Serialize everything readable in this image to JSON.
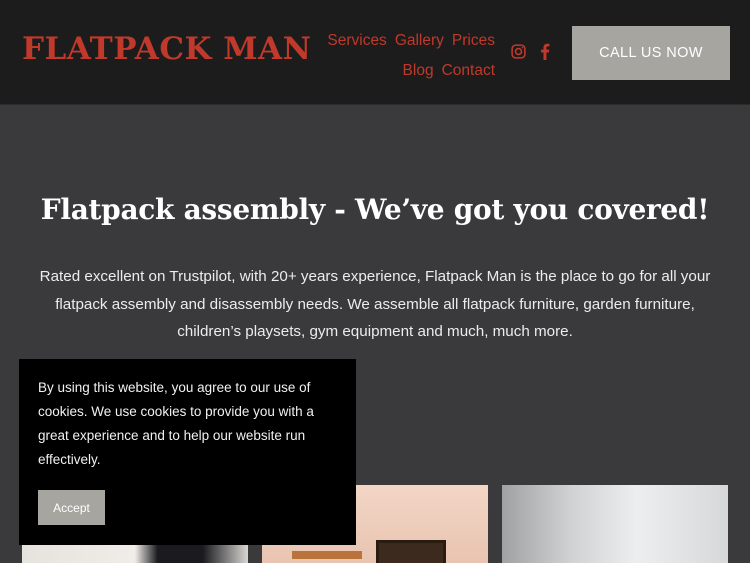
{
  "header": {
    "logo": "FLATPACK MAN",
    "nav": [
      "Services",
      "Gallery",
      "Prices",
      "Blog",
      "Contact"
    ],
    "social": [
      {
        "icon": "instagram-icon"
      },
      {
        "icon": "facebook-icon"
      }
    ],
    "cta_label": "CALL US NOW"
  },
  "hero": {
    "title": "Flatpack assembly - We’ve got you covered!",
    "text": "Rated excellent on Trustpilot, with 20+ years experience, Flatpack Man is the place to go for all your flatpack assembly and disassembly needs. We assemble all flatpack furniture, garden furniture, children’s playsets, gym equipment and much, much more."
  },
  "cookie_banner": {
    "text": "By using this website, you agree to our use of cookies. We use cookies to provide you with a great experience and to help our website run effectively.",
    "accept_label": "Accept"
  },
  "colors": {
    "accent": "#c0392b",
    "header_bg": "#1c1c1d",
    "page_bg": "#3a3a3c",
    "button_bg": "#a6a5a0"
  }
}
